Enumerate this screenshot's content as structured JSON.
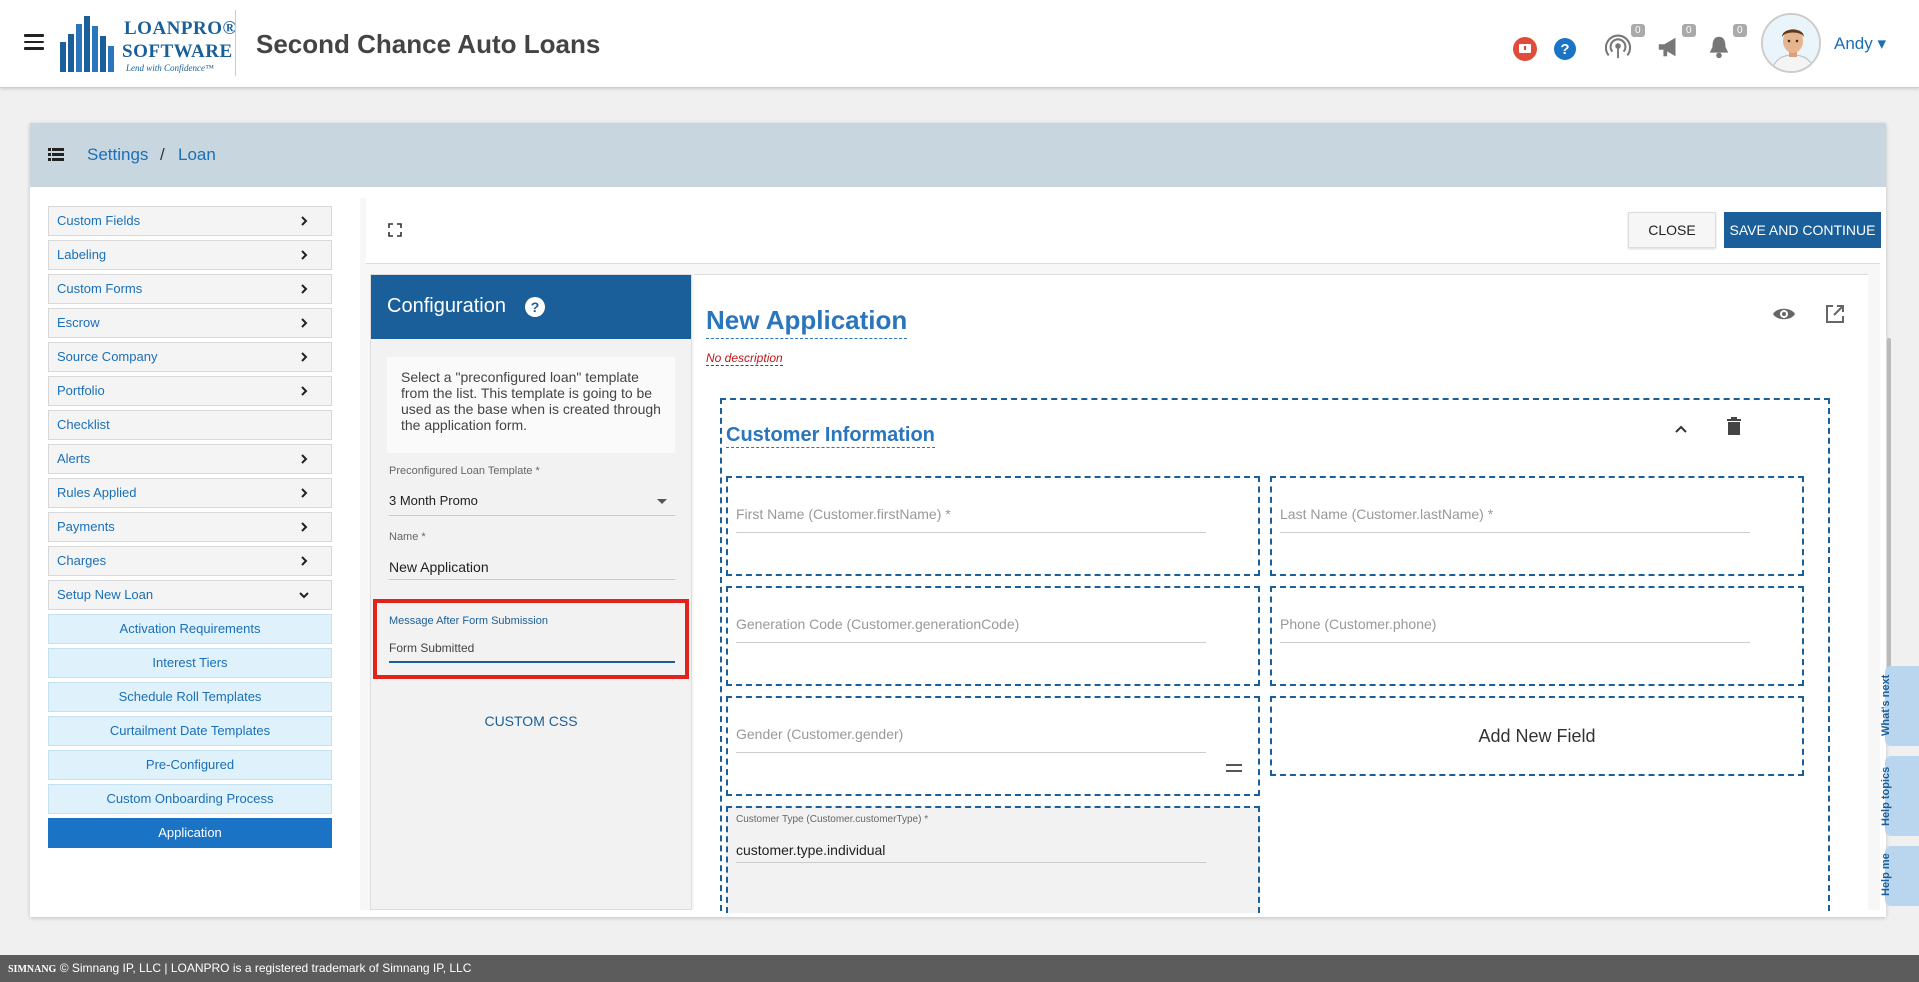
{
  "app": {
    "logo_line1": "LOANPRO®",
    "logo_line2": "SOFTWARE",
    "logo_tagline": "Lend with Confidence™",
    "company": "Second Chance Auto Loans",
    "user": "Andy ▾",
    "badges": {
      "broadcast": "0",
      "announcements": "0",
      "notifications": "0"
    }
  },
  "breadcrumb": {
    "settings": "Settings",
    "separator": "/",
    "loan": "Loan"
  },
  "sidebar": {
    "items": [
      {
        "label": "Custom Fields",
        "has_arrow": true
      },
      {
        "label": "Labeling",
        "has_arrow": true
      },
      {
        "label": "Custom Forms",
        "has_arrow": true
      },
      {
        "label": "Escrow",
        "has_arrow": true
      },
      {
        "label": "Source Company",
        "has_arrow": true
      },
      {
        "label": "Portfolio",
        "has_arrow": true
      },
      {
        "label": "Checklist",
        "has_arrow": false
      },
      {
        "label": "Alerts",
        "has_arrow": true
      },
      {
        "label": "Rules Applied",
        "has_arrow": true
      },
      {
        "label": "Payments",
        "has_arrow": true
      },
      {
        "label": "Charges",
        "has_arrow": true
      },
      {
        "label": "Setup New Loan",
        "has_arrow": true
      }
    ],
    "subitems": [
      "Activation Requirements",
      "Interest Tiers",
      "Schedule Roll Templates",
      "Curtailment Date Templates",
      "Pre-Configured",
      "Custom Onboarding Process",
      "Application"
    ]
  },
  "toolbar": {
    "close": "CLOSE",
    "save": "SAVE AND CONTINUE"
  },
  "config": {
    "title": "Configuration",
    "help": "?",
    "note": "Select a \"preconfigured loan\" template from the list. This template is going to be used as the base when is created through the application form.",
    "template_label": "Preconfigured Loan Template *",
    "template_value": "3 Month Promo",
    "name_label": "Name *",
    "name_value": "New Application",
    "message_label": "Message After Form Submission",
    "message_value": "Form Submitted",
    "custom_css": "CUSTOM CSS"
  },
  "form": {
    "title": "New Application",
    "description": "No description",
    "section_title": "Customer Information",
    "fields": {
      "first_name": "First Name (Customer.firstName) *",
      "last_name": "Last Name (Customer.lastName) *",
      "generation_code": "Generation Code (Customer.generationCode)",
      "phone": "Phone (Customer.phone)",
      "gender": "Gender (Customer.gender)",
      "add_new": "Add New Field",
      "customer_type_label": "Customer Type (Customer.customerType) *",
      "customer_type_value": "customer.type.individual"
    }
  },
  "help_tabs": [
    "What's next",
    "Help topics",
    "Help me"
  ],
  "footer": {
    "brand": "SIMNANG",
    "text": "© Simnang IP, LLC | LOANPRO is a registered trademark of Simnang IP, LLC"
  },
  "colors": {
    "primary": "#1a5f99",
    "link": "#1a6fb8",
    "highlight": "#e0241c",
    "crumbbar": "#c8d6df"
  }
}
